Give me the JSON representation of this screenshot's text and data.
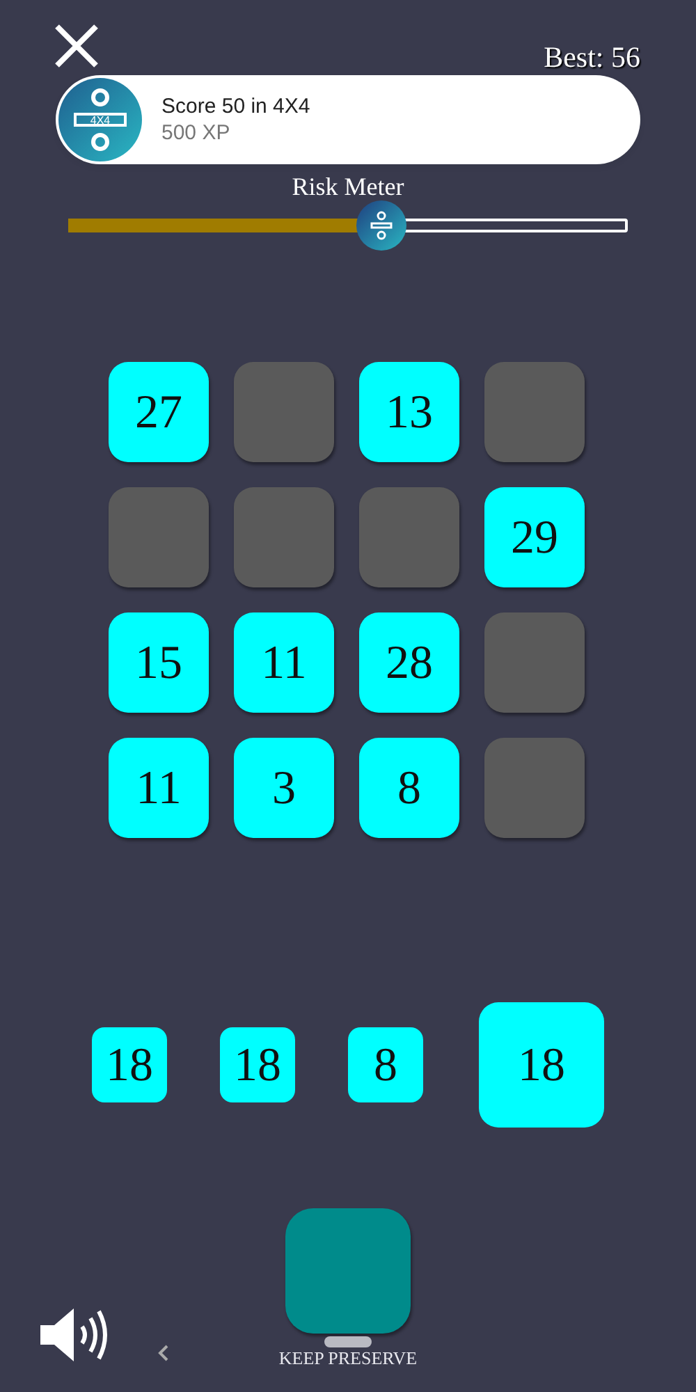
{
  "header": {
    "best": "Best: 56"
  },
  "toast": {
    "title": "Score 50 in 4X4",
    "subtitle": "500 XP",
    "badge": "4X4"
  },
  "risk_meter": {
    "label": "Risk Meter",
    "level": 0.56
  },
  "board": [
    [
      {
        "kind": "number",
        "value": "27"
      },
      {
        "kind": "empty"
      },
      {
        "kind": "number",
        "value": "13"
      },
      {
        "kind": "empty"
      }
    ],
    [
      {
        "kind": "empty"
      },
      {
        "kind": "empty"
      },
      {
        "kind": "empty"
      },
      {
        "kind": "number",
        "value": "29"
      }
    ],
    [
      {
        "kind": "number",
        "value": "15"
      },
      {
        "kind": "number",
        "value": "11"
      },
      {
        "kind": "number",
        "value": "28"
      },
      {
        "kind": "empty"
      }
    ],
    [
      {
        "kind": "number",
        "value": "11"
      },
      {
        "kind": "number",
        "value": "3"
      },
      {
        "kind": "number",
        "value": "8"
      },
      {
        "kind": "empty"
      }
    ]
  ],
  "queue": [
    {
      "value": "18",
      "kind": "small"
    },
    {
      "value": "18",
      "kind": "small"
    },
    {
      "value": "8",
      "kind": "small"
    },
    {
      "value": "18",
      "kind": "large"
    }
  ],
  "preserve": {
    "label": "KEEP PRESERVE"
  }
}
